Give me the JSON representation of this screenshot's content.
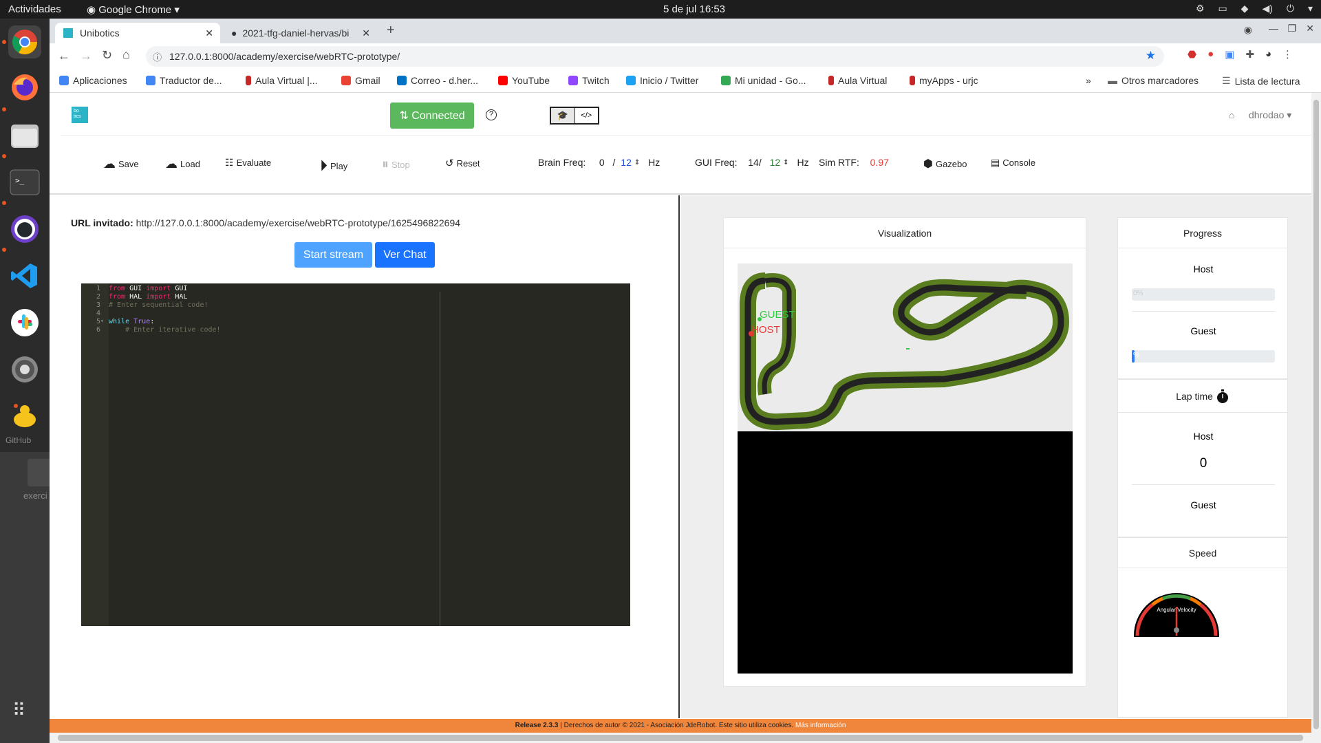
{
  "system_bar": {
    "activities": "Actividades",
    "app_name": "Google Chrome",
    "clock": "5 de jul  16:53"
  },
  "dock": {
    "desktop_folder_label": "exerci",
    "github_label": "GitHub"
  },
  "browser": {
    "tabs": [
      {
        "title": "Unibotics"
      },
      {
        "title": "2021-tfg-daniel-hervas/bi"
      }
    ],
    "url": "127.0.0.1:8000/academy/exercise/webRTC-prototype/",
    "bookmarks": [
      {
        "label": "Aplicaciones",
        "color": "#4285f4"
      },
      {
        "label": "Traductor de...",
        "color": "#4285f4"
      },
      {
        "label": "Aula Virtual |...",
        "color": "#c62828"
      },
      {
        "label": "Gmail",
        "color": "#ea4335"
      },
      {
        "label": "Correo - d.her...",
        "color": "#0072c6"
      },
      {
        "label": "YouTube",
        "color": "#ff0000"
      },
      {
        "label": "Twitch",
        "color": "#9146ff"
      },
      {
        "label": "Inicio / Twitter",
        "color": "#1da1f2"
      },
      {
        "label": "Mi unidad - Go...",
        "color": "#34a853"
      },
      {
        "label": "Aula Virtual",
        "color": "#c62828"
      },
      {
        "label": "myApps - urjc",
        "color": "#c62828"
      }
    ],
    "other_bookmarks": "Otros marcadores",
    "reading_list": "Lista de lectura",
    "more": "»"
  },
  "navbar": {
    "logo_text": "bo tics",
    "connected_label": "⇅ Connected",
    "help": "?",
    "user": "dhrodao"
  },
  "toolbar": {
    "save": "Save",
    "load": "Load",
    "evaluate": "Evaluate",
    "play": "Play",
    "stop": "Stop",
    "reset": "Reset",
    "brain_freq_label": "Brain Freq:",
    "brain_freq_value": "0",
    "brain_freq_target": "12",
    "hz": "Hz",
    "gui_freq_label": "GUI Freq:",
    "gui_freq_value": "14/",
    "gui_freq_target": "12",
    "sim_rtf_label": "Sim RTF:",
    "sim_rtf_value": "0.97",
    "gazebo": "Gazebo",
    "console": "Console"
  },
  "left": {
    "url_label": "URL invitado:",
    "url_value": "http://127.0.0.1:8000/academy/exercise/webRTC-prototype/1625496822694",
    "start_stream": "Start stream",
    "ver_chat": "Ver Chat",
    "code_lines": [
      {
        "n": "1",
        "kw1": "from",
        "t1": " GUI ",
        "kw2": "import",
        "t2": " GUI",
        "comment": ""
      },
      {
        "n": "2",
        "kw1": "from",
        "t1": " HAL ",
        "kw2": "import",
        "t2": " HAL",
        "comment": ""
      },
      {
        "n": "3",
        "kw1": "",
        "t1": "",
        "kw2": "",
        "t2": "",
        "comment": "# Enter sequential code!"
      },
      {
        "n": "4",
        "kw1": "",
        "t1": "",
        "kw2": "",
        "t2": "",
        "comment": ""
      },
      {
        "n": "5",
        "kw1": "while",
        "t1": " ",
        "kw2": "True",
        "t2": ":",
        "comment": ""
      },
      {
        "n": "6",
        "kw1": "",
        "t1": "",
        "kw2": "",
        "t2": "",
        "comment": "    # Enter iterative code!"
      }
    ]
  },
  "visualization": {
    "title": "Visualization",
    "guest_marker": "GUEST",
    "host_marker": "HOST"
  },
  "progress": {
    "title": "Progress",
    "host_label": "Host",
    "host_percent": 0,
    "host_text": "0%",
    "guest_label": "Guest",
    "guest_percent": 2,
    "guest_text": "%"
  },
  "lap_time": {
    "title": "Lap time",
    "host_label": "Host",
    "host_value": "0",
    "guest_label": "Guest"
  },
  "speed": {
    "title": "Speed",
    "gauge_label": "Angular Velocity"
  },
  "footer": {
    "release": "Release 2.3.3",
    "text": " | Derechos de autor © 2021 - Asociación JdeRobot. Este sitio utiliza cookies. ",
    "more_info": "Más información"
  },
  "colors": {
    "connected_green": "#5cb85c",
    "primary_blue": "#2b7cff",
    "footer_orange": "#f0863b",
    "rtf_red": "#e53935"
  }
}
